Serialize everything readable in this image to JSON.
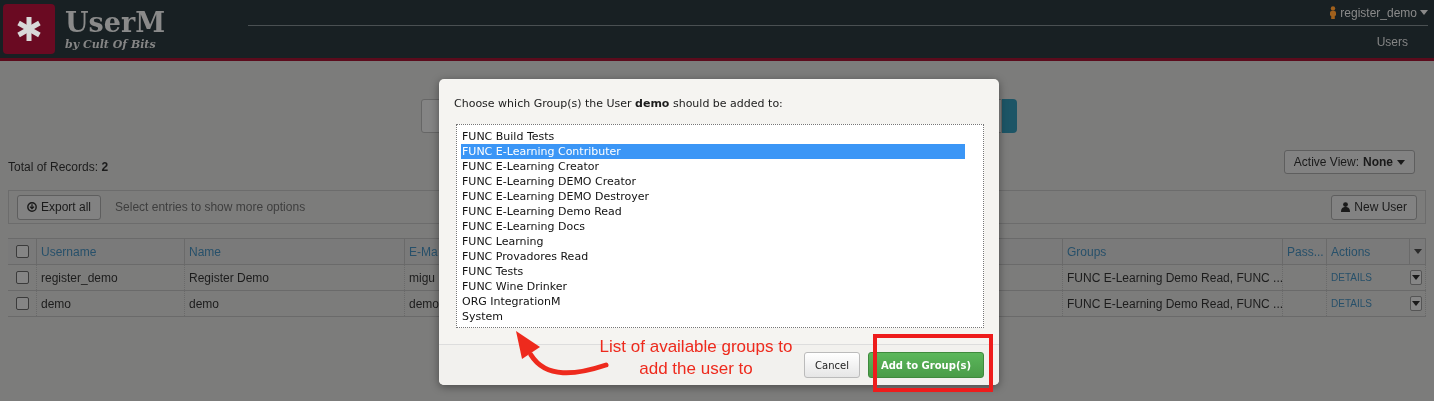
{
  "header": {
    "logo_title": "UserM",
    "logo_subtitle": "by Cult Of Bits",
    "user_menu": "register_demo",
    "nav": [
      "Users"
    ]
  },
  "page": {
    "total": "Total of Records: **2**",
    "active_view": "Active View: **None**",
    "export_button": "Export all",
    "selection_hint": "Select entries to show more options",
    "new_user_button": "New User"
  },
  "table": {
    "header_checked": false,
    "columns": [
      "Username",
      "Name",
      "E-Ma",
      "Groups",
      "Pass...",
      "Actions"
    ],
    "rows": [
      {
        "checked": false,
        "cells": [
          "register_demo",
          "Register Demo",
          "migu",
          "FUNC E-Learning Demo Read, FUNC ..."
        ],
        "action": "DETAILS"
      },
      {
        "checked": false,
        "cells": [
          "demo",
          "demo",
          "demo",
          "FUNC E-Learning Demo Read, FUNC ..."
        ],
        "action": "DETAILS"
      }
    ]
  },
  "modal": {
    "prompt": "Choose which Group(s) the User **demo** should be added to:",
    "groups": [
      {
        "label": "FUNC Build Tests",
        "selected": false
      },
      {
        "label": "FUNC E-Learning Contributer",
        "selected": true
      },
      {
        "label": "FUNC E-Learning Creator",
        "selected": false
      },
      {
        "label": "FUNC E-Learning DEMO Creator",
        "selected": false
      },
      {
        "label": "FUNC E-Learning DEMO Destroyer",
        "selected": false
      },
      {
        "label": "FUNC E-Learning Demo Read",
        "selected": false
      },
      {
        "label": "FUNC E-Learning Docs",
        "selected": false
      },
      {
        "label": "FUNC Learning",
        "selected": false
      },
      {
        "label": "FUNC Provadores Read",
        "selected": false
      },
      {
        "label": "FUNC Tests",
        "selected": false
      },
      {
        "label": "FUNC Wine Drinker",
        "selected": false
      },
      {
        "label": "ORG IntegrationM",
        "selected": false
      },
      {
        "label": "System",
        "selected": false
      }
    ],
    "cancel_button": "Cancel",
    "confirm_button": "Add to Group(s)"
  },
  "annotation": {
    "lines": [
      "List of available groups to",
      "add the user to"
    ]
  }
}
